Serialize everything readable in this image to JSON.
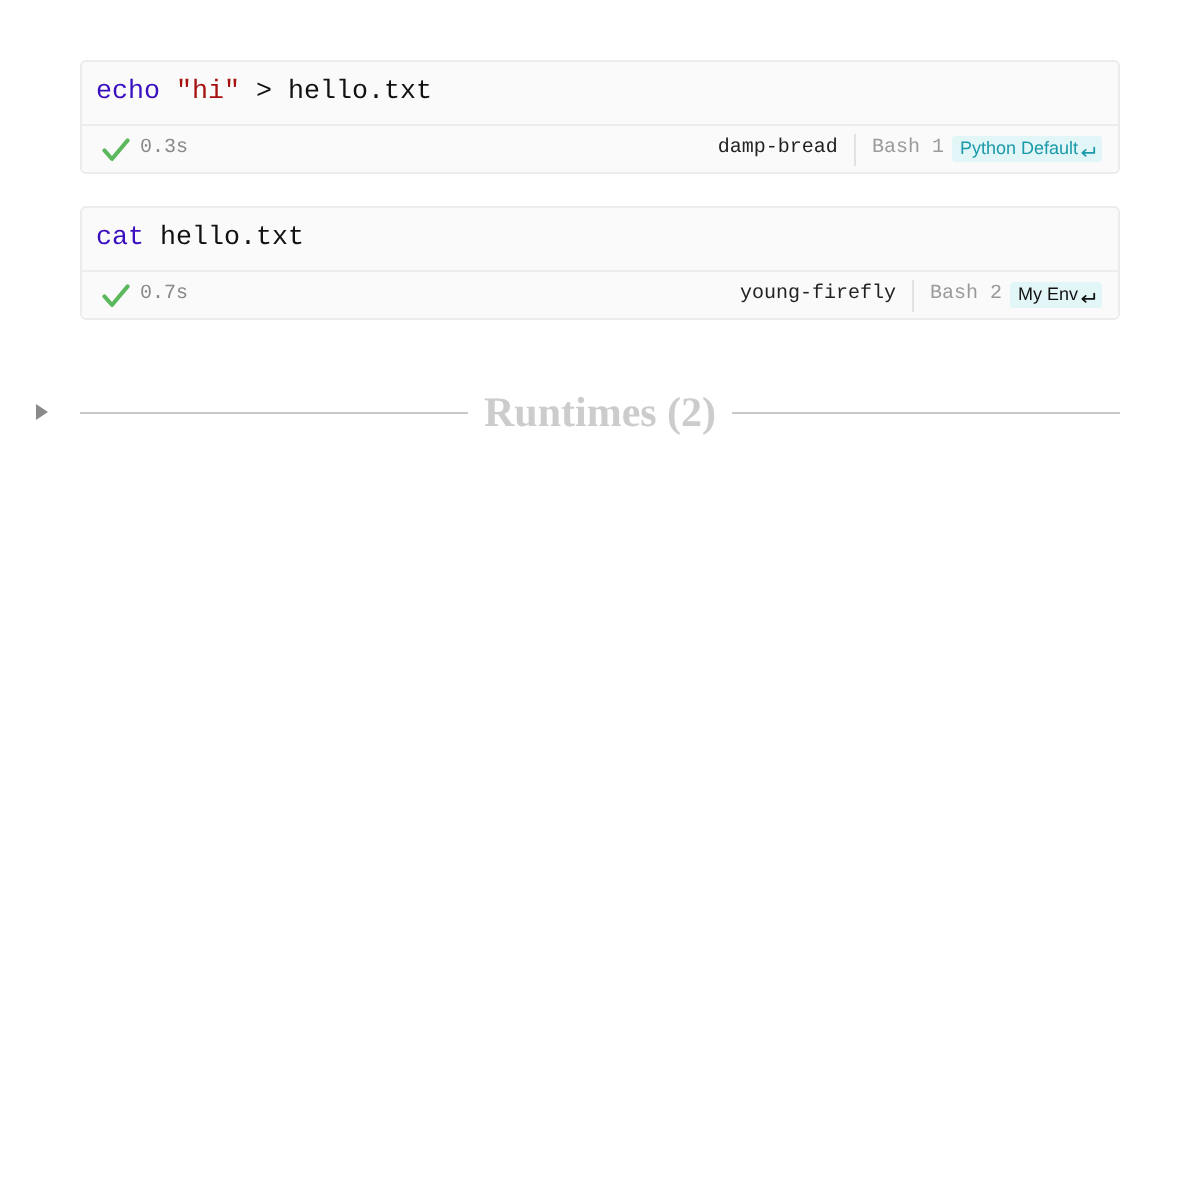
{
  "cells": [
    {
      "code": [
        {
          "kind": "keyword",
          "text": "echo"
        },
        {
          "kind": "string",
          "text": " \"hi\""
        },
        {
          "kind": "plain",
          "text": " > hello.txt"
        }
      ],
      "passed": true,
      "duration": "0.3s",
      "name": "damp-bread",
      "kernel": "Bash 1",
      "environment": {
        "label": "Python Default",
        "color": "#1a9aa8"
      }
    },
    {
      "code": [
        {
          "kind": "keyword",
          "text": "cat"
        },
        {
          "kind": "plain",
          "text": " hello.txt"
        }
      ],
      "passed": true,
      "duration": "0.7s",
      "name": "young-firefly",
      "kernel": "Bash 2",
      "environment": {
        "label": "My Env",
        "color": "#111111"
      }
    }
  ],
  "runtimes": {
    "title": "Runtimes (2)",
    "expanded": false
  }
}
